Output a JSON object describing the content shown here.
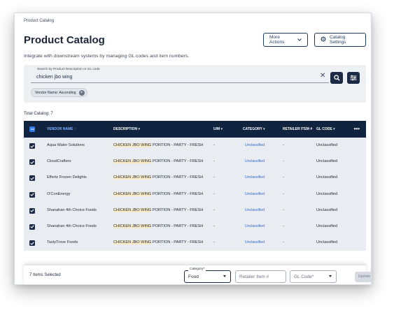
{
  "breadcrumb": "Product Catalog",
  "title": "Product Catalog",
  "actions": {
    "more": "More Actions",
    "settings": "Catalog Settings"
  },
  "subtitle": "Integrate with downstream systems by managing GL codes and item numbers.",
  "search": {
    "label": "Search by Product Description or GL code",
    "value": "chicken jbo wing"
  },
  "chip": "Vendor Name: Ascending",
  "total": "Total Catalog: 7",
  "columns": {
    "vendor": "VENDOR NAME ↑",
    "description": "DESCRIPTION ▾",
    "um": "U/M ▾",
    "category": "CATEGORY ▾",
    "retailer": "RETAILER ITEM #",
    "gl": "GL CODE ▾",
    "more": "•••"
  },
  "highlight": "CHICKEN JBO WING",
  "rows": [
    {
      "vendor": "Aqua Water Solutions",
      "desc_rest": " PORTION - PARTY - FRESH",
      "um": "-",
      "category": "Unclassified",
      "retailer": "-",
      "gl": "Unclassified"
    },
    {
      "vendor": "CloudCrafters",
      "desc_rest": " PORTION - PARTY - FRESH",
      "um": "-",
      "category": "Unclassified",
      "retailer": "-",
      "gl": "Unclassified"
    },
    {
      "vendor": "Effertz Frozen Delights",
      "desc_rest": " PORTION - PARTY - FRESH",
      "um": "-",
      "category": "Unclassified",
      "retailer": "-",
      "gl": "Unclassified"
    },
    {
      "vendor": "O'ConEnergy",
      "desc_rest": " PORTION - PARTY - FRESH",
      "um": "-",
      "category": "Unclassified",
      "retailer": "-",
      "gl": "Unclassified"
    },
    {
      "vendor": "Shanahan 4th Choice Foods",
      "desc_rest": " PORTION - PARTY - FRESH",
      "um": "-",
      "category": "Unclassified",
      "retailer": "-",
      "gl": "Unclassified"
    },
    {
      "vendor": "Shanahan 4th Choice Foods",
      "desc_rest": " PORTION - PARTY - FRESH",
      "um": "-",
      "category": "Unclassified",
      "retailer": "-",
      "gl": "Unclassified"
    },
    {
      "vendor": "TastyTrove Foods",
      "desc_rest": " PORTION - PARTY - FRESH",
      "um": "-",
      "category": "Unclassified",
      "retailer": "-",
      "gl": "Unclassified"
    }
  ],
  "footer": {
    "selected": "7 Items Selected",
    "category_label": "Category*",
    "category_value": "Food",
    "retailer_placeholder": "Retailer Item #",
    "gl_placeholder": "GL Code*",
    "update": "Update"
  },
  "colors": {
    "header_bg": "#11243f",
    "accent": "#2f79e6",
    "highlight": "#f8e9c3"
  }
}
